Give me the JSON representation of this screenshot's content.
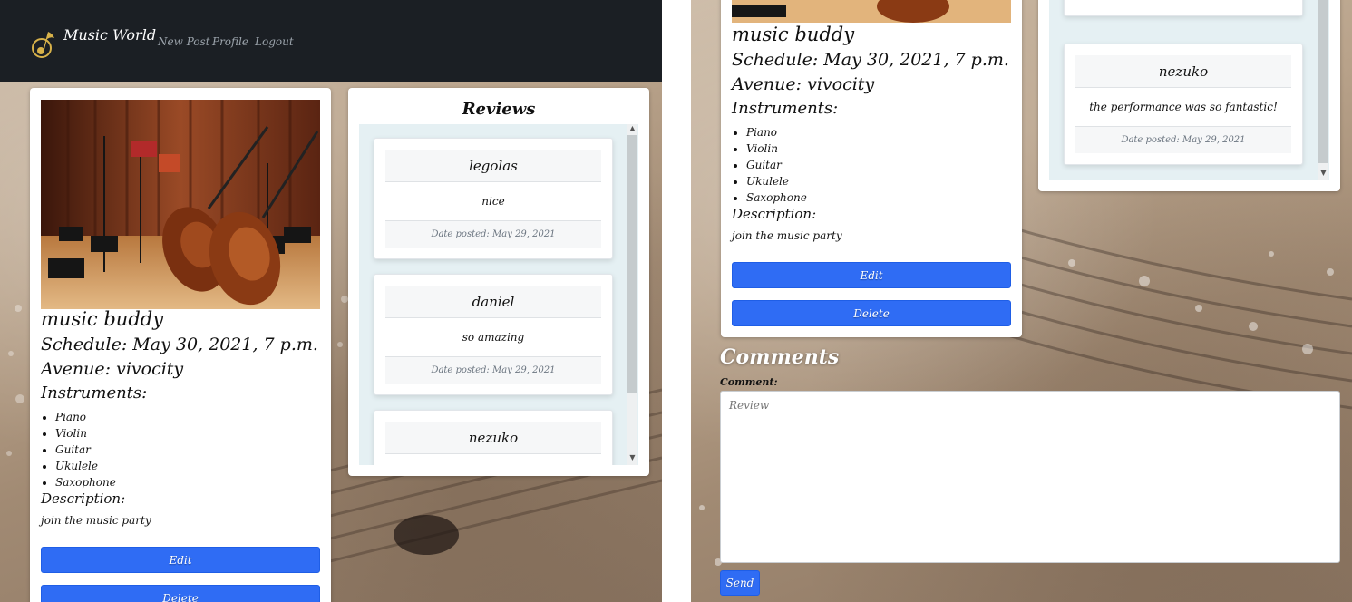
{
  "navbar": {
    "brand": "Music World",
    "links": [
      "New Post",
      "Profile",
      "Logout"
    ]
  },
  "post": {
    "title": "music buddy",
    "schedule": "Schedule: May 30, 2021, 7 p.m.",
    "avenue": "Avenue: vivocity",
    "instruments_label": "Instruments:",
    "instruments": [
      "Piano",
      "Violin",
      "Guitar",
      "Ukulele",
      "Saxophone"
    ],
    "description_label": "Description:",
    "description": "join the music party",
    "edit_label": "Edit",
    "delete_label": "Delete"
  },
  "reviews": {
    "title": "Reviews",
    "items": [
      {
        "author": "legolas",
        "text": "nice",
        "date": "Date posted: May 29, 2021"
      },
      {
        "author": "daniel",
        "text": "so amazing",
        "date": "Date posted: May 29, 2021"
      },
      {
        "author": "nezuko",
        "text": "the performance was so fantastic!",
        "date": "Date posted: May 29, 2021"
      }
    ]
  },
  "comments": {
    "heading": "Comments",
    "label": "Comment:",
    "placeholder": "Review",
    "send_label": "Send"
  },
  "colors": {
    "navbar": "#1b1f24",
    "primary_button": "#2f6cf4",
    "reviews_bg": "#e5f0f3"
  },
  "icons": {
    "brand": "music-note-logo-icon"
  }
}
